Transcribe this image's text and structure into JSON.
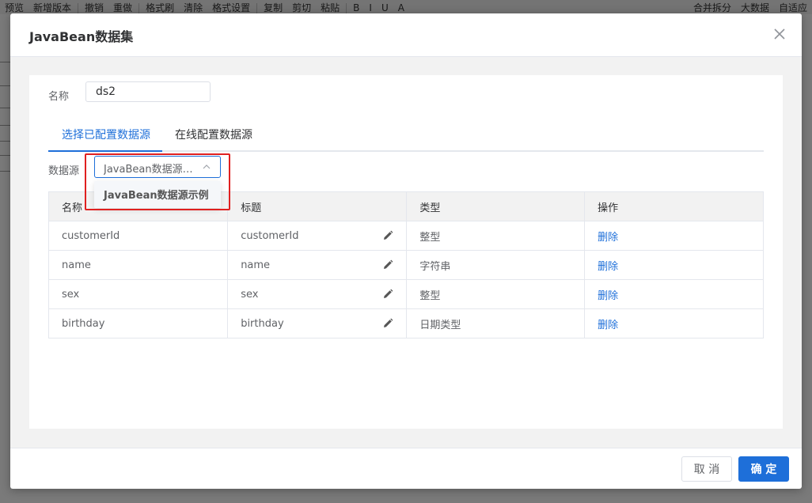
{
  "background_toolbar": [
    "预览",
    "新增版本",
    "撤销",
    "重做",
    "格式刷",
    "清除",
    "格式设置",
    "复制",
    "剪切",
    "粘贴",
    "B",
    "I",
    "U",
    "A",
    "合并拆分",
    "大数据",
    "自适应"
  ],
  "dialog": {
    "title": "JavaBean数据集",
    "name_label": "名称",
    "name_value": "ds2",
    "tabs": [
      {
        "label": "选择已配置数据源",
        "active": true
      },
      {
        "label": "在线配置数据源",
        "active": false
      }
    ],
    "datasource_label": "数据源",
    "datasource_selected": "JavaBean数据源示例",
    "datasource_options": [
      "JavaBean数据源示例"
    ],
    "table": {
      "headers": [
        "名称",
        "标题",
        "类型",
        "操作"
      ],
      "rows": [
        {
          "name": "customerId",
          "title": "customerId",
          "type": "整型",
          "action": "删除"
        },
        {
          "name": "name",
          "title": "name",
          "type": "字符串",
          "action": "删除"
        },
        {
          "name": "sex",
          "title": "sex",
          "type": "整型",
          "action": "删除"
        },
        {
          "name": "birthday",
          "title": "birthday",
          "type": "日期类型",
          "action": "删除"
        }
      ]
    },
    "footer": {
      "cancel_label": "取 消",
      "ok_label": "确 定"
    }
  },
  "colors": {
    "accent": "#1e6fd9",
    "highlight": "#e02020"
  },
  "icons": [
    "close-icon",
    "chevron-up-icon",
    "edit-pencil-icon"
  ]
}
